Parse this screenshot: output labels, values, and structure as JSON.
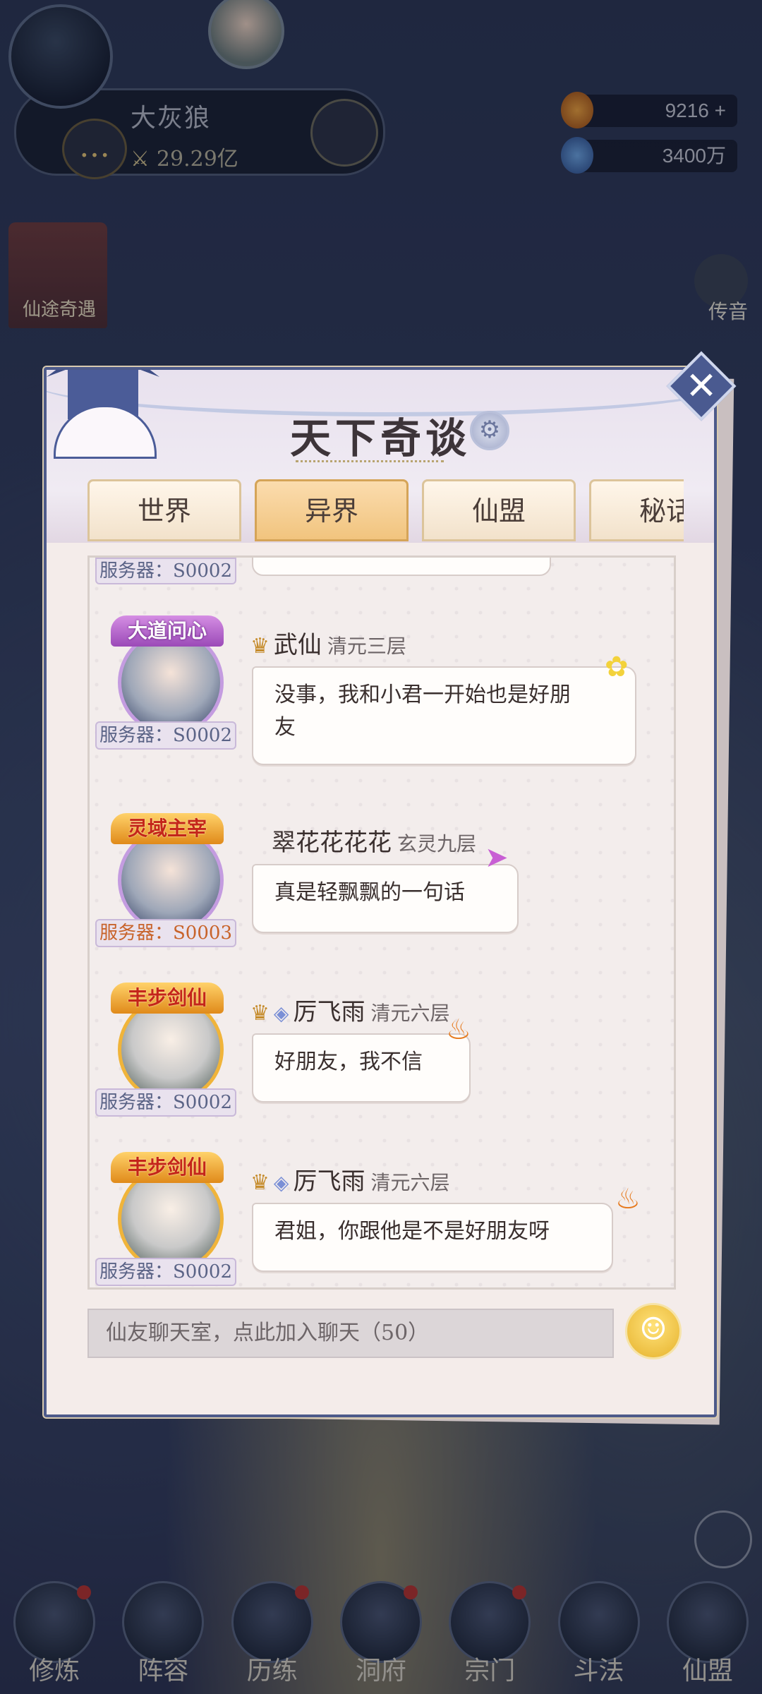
{
  "hud": {
    "player_name": "大灰狼",
    "combat_power": "29.29亿",
    "resource_1": "9216",
    "resource_1_plus": "+",
    "resource_2": "3400万",
    "left_event_label": "仙途奇遇",
    "right_mail_label": "传音"
  },
  "bottom_nav": [
    {
      "label": "修炼"
    },
    {
      "label": "阵容"
    },
    {
      "label": "历练"
    },
    {
      "label": "洞府"
    },
    {
      "label": "宗门"
    },
    {
      "label": "斗法"
    },
    {
      "label": "仙盟"
    }
  ],
  "dialog": {
    "title": "天下奇谈",
    "close_glyph": "✕",
    "tabs": [
      {
        "label": "世界",
        "active": false
      },
      {
        "label": "异界",
        "active": true
      },
      {
        "label": "仙盟",
        "active": false
      },
      {
        "label": "秘话",
        "active": false
      }
    ],
    "partial_server": "服务器：S0002",
    "messages": [
      {
        "badge": "大道问心",
        "server": "服务器：S0002",
        "name": "武仙",
        "realm": "清元三层",
        "text_line1": "没事，我和小君一开始也是好朋",
        "text_line2": "友"
      },
      {
        "badge": "灵域主宰",
        "server": "服务器：S0003",
        "name": "翠花花花花",
        "realm": "玄灵九层",
        "text_line1": "真是轻飘飘的一句话"
      },
      {
        "badge": "丰步剑仙",
        "server": "服务器：S0002",
        "name": "厉飞雨",
        "realm": "清元六层",
        "text_line1": "好朋友，我不信"
      },
      {
        "badge": "丰步剑仙",
        "server": "服务器：S0002",
        "name": "厉飞雨",
        "realm": "清元六层",
        "text_line1": "君姐，你跟他是不是好朋友呀"
      }
    ],
    "input_placeholder": "仙友聊天室，点此加入聊天（50）"
  }
}
